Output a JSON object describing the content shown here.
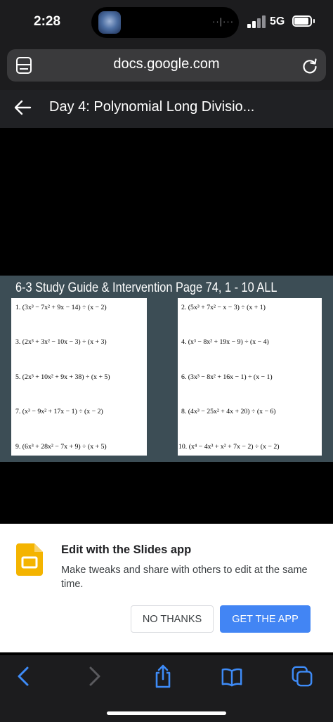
{
  "status_bar": {
    "time": "2:28",
    "network": "5G",
    "wave": "··|···"
  },
  "browser": {
    "url": "docs.google.com"
  },
  "doc": {
    "title": "Day 4: Polynomial Long Divisio..."
  },
  "slide": {
    "title": "6-3 Study Guide & Intervention Page 74,  1 - 10 ALL",
    "problems": [
      "1. (3x³ − 7x² + 9x − 14) ÷ (x − 2)",
      "2. (5x³ + 7x² − x − 3) ÷ (x + 1)",
      "3. (2x³ + 3x² − 10x − 3) ÷ (x + 3)",
      "4. (x³ − 8x² + 19x − 9) ÷ (x − 4)",
      "5. (2x³ + 10x² + 9x + 38) ÷ (x + 5)",
      "6. (3x³ − 8x² + 16x − 1) ÷ (x − 1)",
      "7. (x³ − 9x² + 17x − 1) ÷ (x − 2)",
      "8. (4x³ − 25x² + 4x + 20) ÷ (x − 6)",
      "9. (6x³ + 28x² − 7x + 9) ÷ (x + 5)",
      "10. (x⁴ − 4x³ + x² + 7x − 2) ÷ (x − 2)"
    ]
  },
  "banner": {
    "title": "Edit with the Slides app",
    "description": "Make tweaks and share with others to edit at the same time.",
    "no_thanks": "NO THANKS",
    "get_app": "GET THE APP"
  },
  "icons": {
    "tabs": "tabs-icon",
    "reload": "reload-icon",
    "back": "arrow-left-icon",
    "slides": "google-slides-icon",
    "nav_back": "chevron-left-icon",
    "nav_forward": "chevron-right-icon",
    "share": "share-icon",
    "bookmarks": "book-icon",
    "tab_switcher": "tab-switcher-icon"
  },
  "colors": {
    "accent": "#4285f4",
    "slides_yellow": "#f4b400",
    "slide_bg": "#3c4d55"
  }
}
